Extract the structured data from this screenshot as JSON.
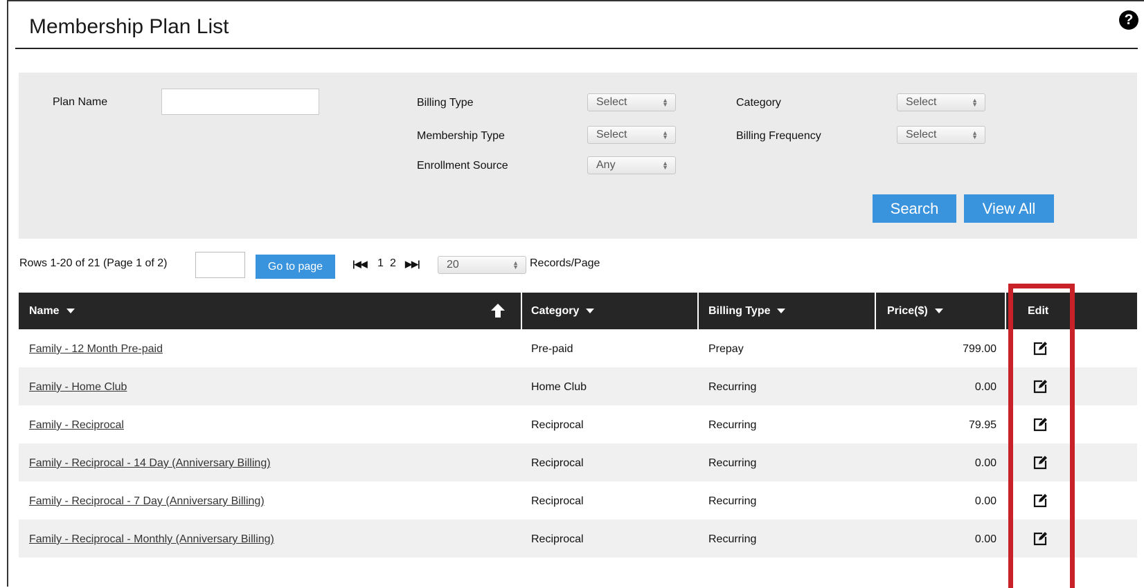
{
  "page": {
    "title": "Membership Plan List",
    "help": "?"
  },
  "filters": {
    "plan_name_label": "Plan Name",
    "plan_name_value": "",
    "billing_type_label": "Billing Type",
    "billing_type_value": "Select",
    "category_label": "Category",
    "category_value": "Select",
    "membership_type_label": "Membership Type",
    "membership_type_value": "Select",
    "billing_frequency_label": "Billing Frequency",
    "billing_frequency_value": "Select",
    "enrollment_source_label": "Enrollment Source",
    "enrollment_source_value": "Any",
    "search_button": "Search",
    "view_all_button": "View All"
  },
  "pager": {
    "rows_info": "Rows 1-20 of 21 (Page 1 of 2)",
    "page_input": "",
    "go_button": "Go to page",
    "first": "⏮",
    "prev": "◀",
    "page1": "1",
    "page2": "2",
    "next": "▶",
    "last": "⏭",
    "records_value": "20",
    "records_label": "Records/Page"
  },
  "grid": {
    "columns": {
      "name": "Name",
      "category": "Category",
      "billing_type": "Billing Type",
      "price": "Price($)",
      "edit": "Edit"
    },
    "rows": [
      {
        "name": "Family - 12 Month Pre-paid",
        "category": "Pre-paid",
        "billing_type": "Prepay",
        "price": "799.00"
      },
      {
        "name": "Family - Home Club",
        "category": "Home Club",
        "billing_type": "Recurring",
        "price": "0.00"
      },
      {
        "name": "Family - Reciprocal",
        "category": "Reciprocal",
        "billing_type": "Recurring",
        "price": "79.95"
      },
      {
        "name": "Family - Reciprocal - 14 Day (Anniversary Billing)",
        "category": "Reciprocal",
        "billing_type": "Recurring",
        "price": "0.00"
      },
      {
        "name": "Family - Reciprocal - 7 Day (Anniversary Billing)",
        "category": "Reciprocal",
        "billing_type": "Recurring",
        "price": "0.00"
      },
      {
        "name": "Family - Reciprocal - Monthly (Anniversary Billing)",
        "category": "Reciprocal",
        "billing_type": "Recurring",
        "price": "0.00"
      }
    ]
  },
  "colors": {
    "accent_button": "#3a94dd",
    "header_bg": "#262626",
    "highlight_border": "#c82127",
    "panel_bg": "#ebebeb"
  }
}
